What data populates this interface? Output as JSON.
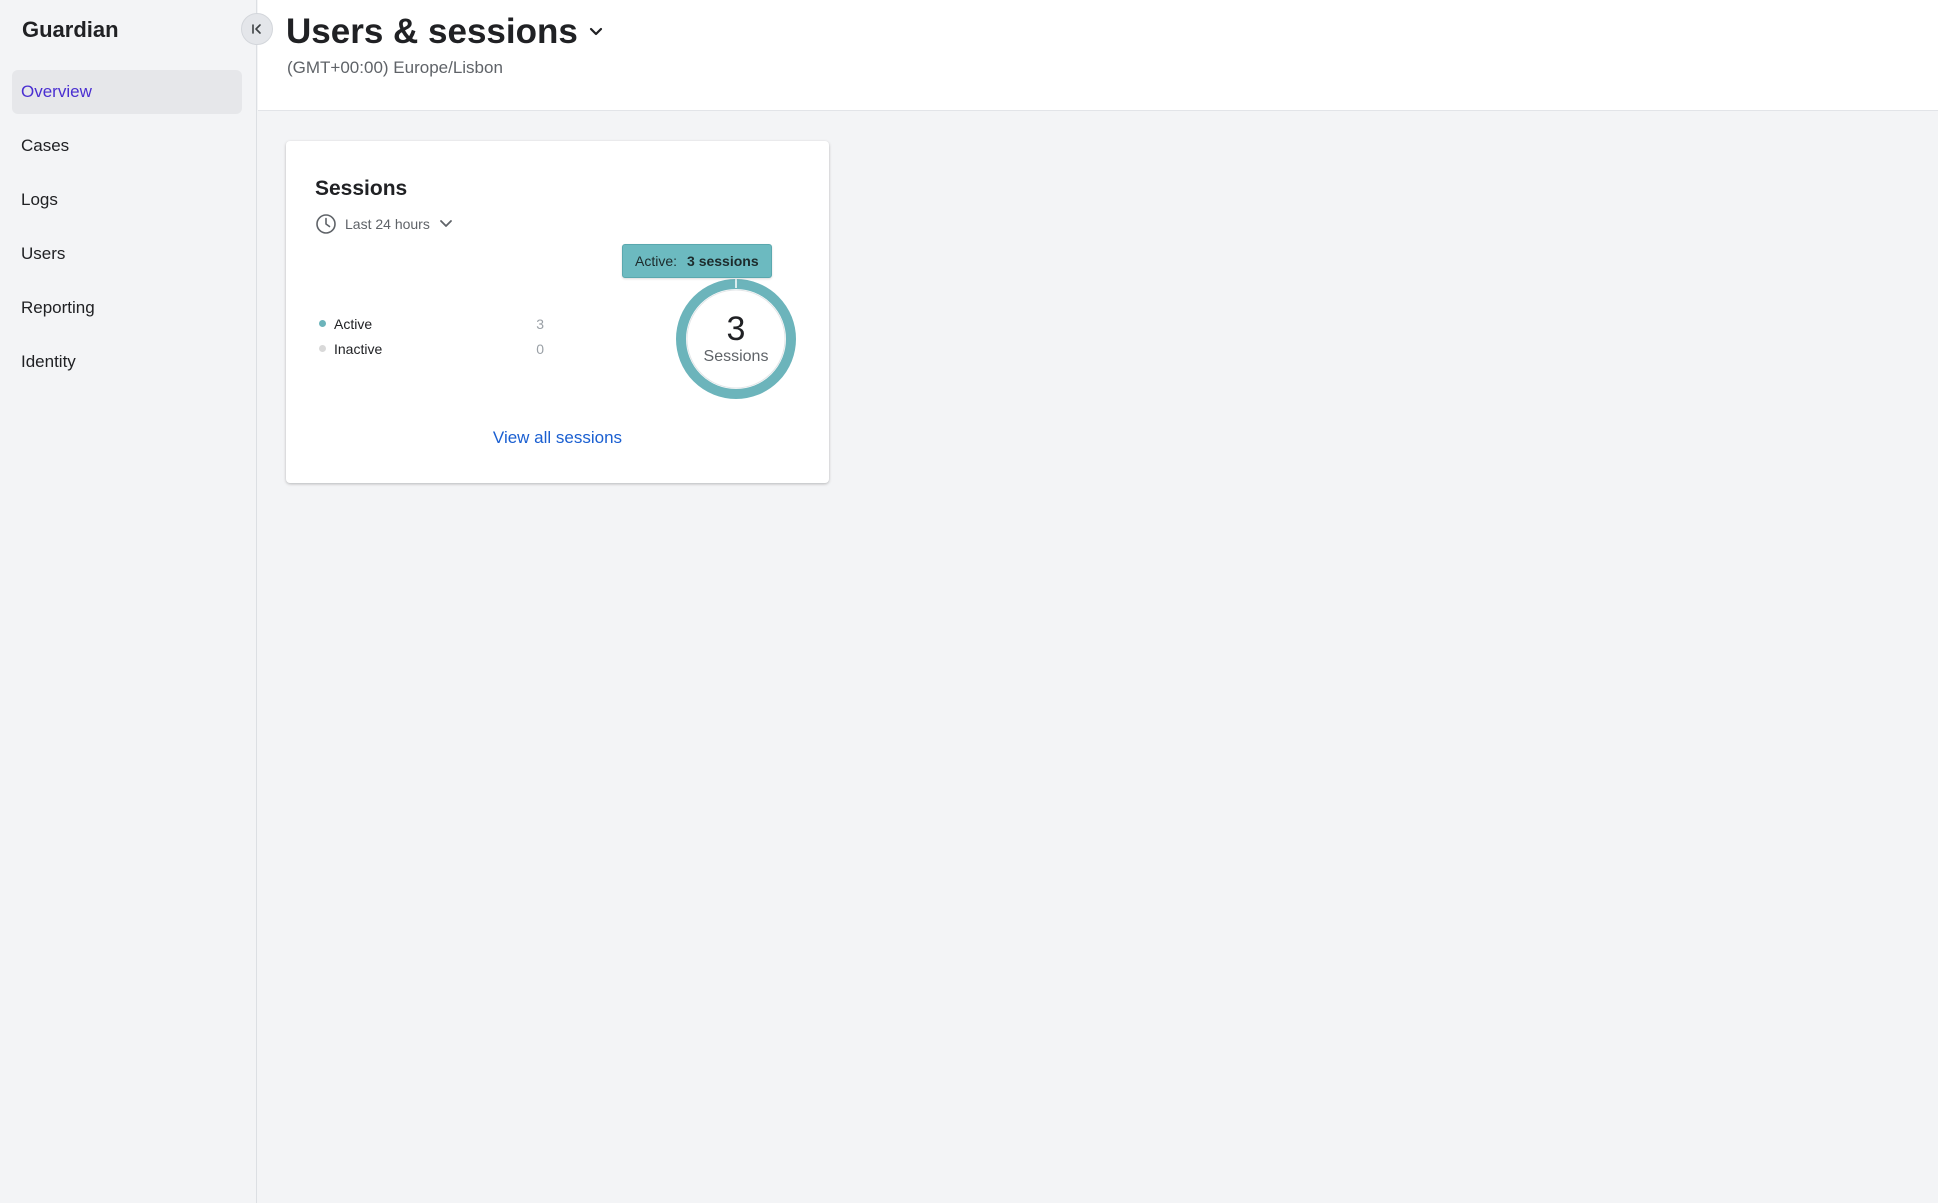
{
  "sidebar": {
    "brand": "Guardian",
    "collapse_icon": "collapse-left-icon",
    "items": [
      {
        "label": "Overview",
        "active": true
      },
      {
        "label": "Cases",
        "active": false
      },
      {
        "label": "Logs",
        "active": false
      },
      {
        "label": "Users",
        "active": false
      },
      {
        "label": "Reporting",
        "active": false
      },
      {
        "label": "Identity",
        "active": false
      }
    ]
  },
  "header": {
    "title": "Users & sessions",
    "title_icon": "chevron-down-icon",
    "timezone": "(GMT+00:00) Europe/Lisbon"
  },
  "sessions_card": {
    "title": "Sessions",
    "time_filter": {
      "icon": "clock-icon",
      "label": "Last 24 hours",
      "dropdown_icon": "chevron-down-icon"
    },
    "legend": [
      {
        "label": "Active",
        "value": "3",
        "color": "#6cb4bb"
      },
      {
        "label": "Inactive",
        "value": "0",
        "color": "#d9d9d9"
      }
    ],
    "donut": {
      "total": "3",
      "caption": "Sessions"
    },
    "tooltip": {
      "label": "Active:",
      "value": "3 sessions"
    },
    "view_all_link": "View all sessions"
  },
  "chart_data": {
    "type": "pie",
    "categories": [
      "Active",
      "Inactive"
    ],
    "values": [
      3,
      0
    ],
    "colors": [
      "#6cb4bb",
      "#d9d9d9"
    ],
    "title": "Sessions",
    "center_label": "3 Sessions"
  }
}
